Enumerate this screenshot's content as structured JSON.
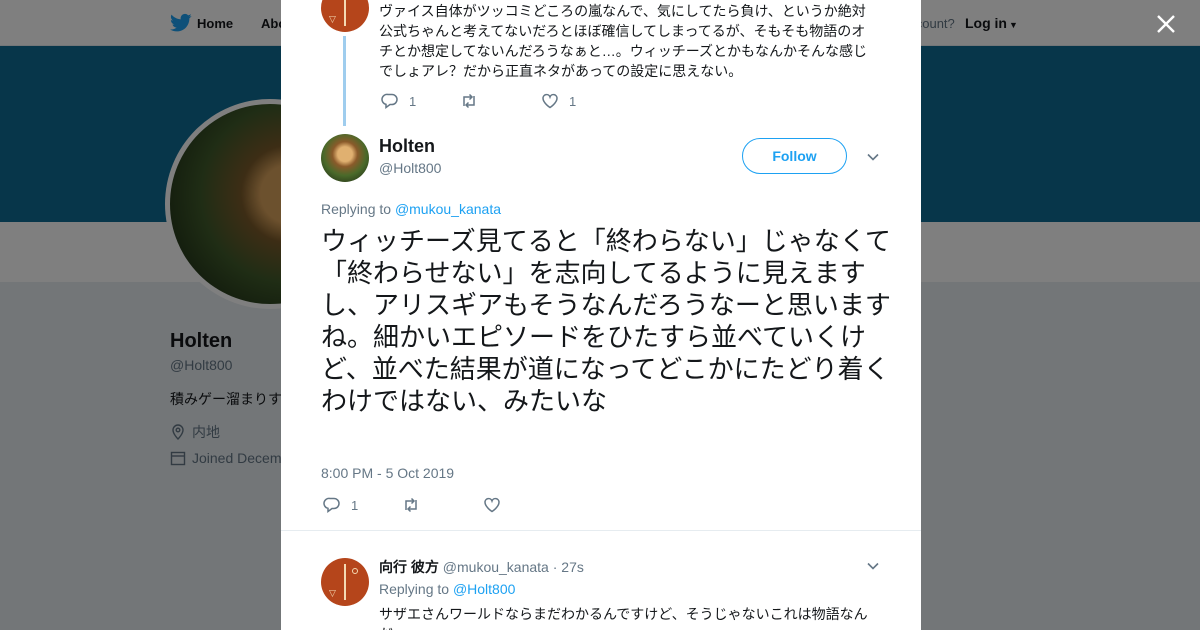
{
  "background": {
    "nav": {
      "home_label": "Home",
      "about_label": "Abo",
      "account_text": "account?",
      "login_label": "Log in"
    },
    "profile": {
      "name": "Holten",
      "handle": "@Holt800",
      "bio": "積みゲー溜まりす",
      "location": "内地",
      "joined": "Joined Decem"
    }
  },
  "previous_tweet": {
    "text": "ヴァイス自体がツッコミどころの嵐なんで、気にしてたら負け、というか絶対公式ちゃんと考えてないだろとほぼ確信してしまってるが、そもそも物語のオチとか想定してないんだろうなぁと…。ウィッチーズとかもなんかそんな感じでしょアレ？だから正直ネタがあっての設定に思えない。",
    "reply_count": "1",
    "like_count": "1"
  },
  "main_tweet": {
    "author_name": "Holten",
    "author_handle": "@Holt800",
    "follow_label": "Follow",
    "replying_prefix": "Replying to",
    "replying_to": "@mukou_kanata",
    "text": "ウィッチーズ見てると「終わらない」じゃなくて「終わらせない」を志向してるように見えますし、アリスギアもそうなんだろうなーと思いますね。細かいエピソードをひたすら並べていくけど、並べた結果が道になってどこかにたどり着くわけではない、みたいな",
    "timestamp": "8:00 PM - 5 Oct 2019",
    "reply_count": "1"
  },
  "reply_tweet": {
    "author_name": "向行 彼方",
    "author_handle": "@mukou_kanata",
    "time_ago": "· 27s",
    "replying_prefix": "Replying to",
    "replying_to": "@Holt800",
    "text": "サザエさんワールドならまだわかるんですけど、そうじゃないこれは物語なんだ"
  },
  "colors": {
    "accent": "#1da1f2",
    "banner": "#0f6c94",
    "thread_line": "#9fcdee"
  }
}
